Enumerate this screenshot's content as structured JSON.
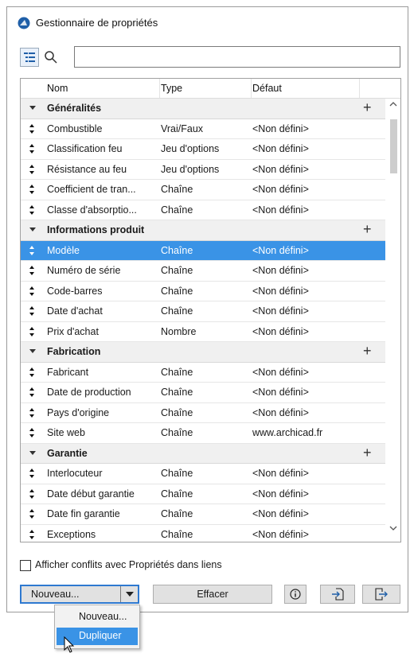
{
  "window": {
    "title": "Gestionnaire de propriétés",
    "accent": "#3a93e6"
  },
  "toolbar": {
    "tree_icon": "tree-view-icon",
    "search_icon": "search-icon",
    "search_value": ""
  },
  "table": {
    "headers": {
      "name": "Nom",
      "type": "Type",
      "default": "Défaut"
    },
    "groups": [
      {
        "label": "Généralités",
        "rows": [
          {
            "name": "Combustible",
            "type": "Vrai/Faux",
            "default": "<Non défini>"
          },
          {
            "name": "Classification feu",
            "type": "Jeu d'options",
            "default": "<Non défini>"
          },
          {
            "name": "Résistance au feu",
            "type": "Jeu d'options",
            "default": "<Non défini>"
          },
          {
            "name": "Coefficient de tran...",
            "type": "Chaîne",
            "default": "<Non défini>"
          },
          {
            "name": "Classe d'absorptio...",
            "type": "Chaîne",
            "default": "<Non défini>"
          }
        ]
      },
      {
        "label": "Informations produit",
        "rows": [
          {
            "name": "Modèle",
            "type": "Chaîne",
            "default": "<Non défini>",
            "selected": true
          },
          {
            "name": "Numéro de série",
            "type": "Chaîne",
            "default": "<Non défini>"
          },
          {
            "name": "Code-barres",
            "type": "Chaîne",
            "default": "<Non défini>"
          },
          {
            "name": "Date d'achat",
            "type": "Chaîne",
            "default": "<Non défini>"
          },
          {
            "name": "Prix d'achat",
            "type": "Nombre",
            "default": "<Non défini>"
          }
        ]
      },
      {
        "label": "Fabrication",
        "rows": [
          {
            "name": "Fabricant",
            "type": "Chaîne",
            "default": "<Non défini>"
          },
          {
            "name": "Date de production",
            "type": "Chaîne",
            "default": "<Non défini>"
          },
          {
            "name": "Pays d'origine",
            "type": "Chaîne",
            "default": "<Non défini>"
          },
          {
            "name": "Site web",
            "type": "Chaîne",
            "default": "www.archicad.fr"
          }
        ]
      },
      {
        "label": "Garantie",
        "rows": [
          {
            "name": "Interlocuteur",
            "type": "Chaîne",
            "default": "<Non défini>"
          },
          {
            "name": "Date début garantie",
            "type": "Chaîne",
            "default": "<Non défini>"
          },
          {
            "name": "Date fin garantie",
            "type": "Chaîne",
            "default": "<Non défini>"
          },
          {
            "name": "Exceptions",
            "type": "Chaîne",
            "default": "<Non défini>"
          }
        ]
      }
    ]
  },
  "options": {
    "conflicts_label": "Afficher conflits avec Propriétés dans liens",
    "conflicts_checked": false
  },
  "buttons": {
    "new_label": "Nouveau...",
    "clear_label": "Effacer",
    "info_icon": "info-icon",
    "import_icon": "import-icon",
    "export_icon": "export-icon"
  },
  "dropdown": {
    "items": [
      "Nouveau...",
      "Dupliquer"
    ],
    "highlighted": "Dupliquer"
  }
}
